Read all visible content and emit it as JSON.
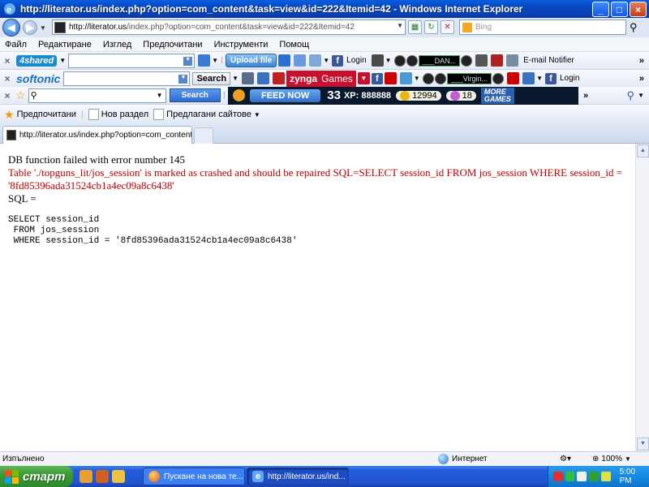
{
  "window": {
    "title": "http://literator.us/index.php?option=com_content&task=view&id=222&Itemid=42 - Windows Internet Explorer"
  },
  "address_bar": {
    "url_domain": "http://literator.us",
    "url_path": "/index.php?option=com_content&task=view&id=222&Itemid=42"
  },
  "search_box": {
    "placeholder": "Bing"
  },
  "menu": [
    "Файл",
    "Редактиране",
    "Изглед",
    "Предпочитани",
    "Инструменти",
    "Помощ"
  ],
  "toolbar_4shared": {
    "logo": "4shared",
    "upload_label": "Upload file",
    "login_label": "Login",
    "player_text": "___DAN...",
    "email_label": "E-mail Notifier"
  },
  "toolbar_softonic": {
    "logo": "softonic",
    "search_label": "Search",
    "zynga_label": "zynga",
    "zynga_games": "Games",
    "player_text": "___Virgin...",
    "login_label": "Login"
  },
  "toolbar_feed": {
    "search_label": "Search",
    "feed_now": "FEED NOW",
    "level": "33",
    "xp": "XP: 888888",
    "coins": "12994",
    "cash": "18",
    "more_games_line1": "MORE",
    "more_games_line2": "GAMES"
  },
  "favorites_bar": {
    "favorites_label": "Предпочитани",
    "new_section": "Нов раздел",
    "suggested_sites": "Предлагани сайтове"
  },
  "tab": {
    "title": "http://literator.us/index.php?option=com_content&ta..."
  },
  "content": {
    "line1": "DB function failed with error number 145",
    "line2": "Table './topguns_lit/jos_session' is marked as crashed and should be repaired SQL=SELECT session_id FROM jos_session WHERE session_id = '8fd85396ada31524cb1a4ec09a8c6438'",
    "line3": "SQL =",
    "sql": "SELECT session_id\n FROM jos_session\n WHERE session_id = '8fd85396ada31524cb1a4ec09a8c6438'"
  },
  "status_bar": {
    "status": "Изпълнено",
    "zone": "Интернет",
    "zoom": "100%"
  },
  "taskbar": {
    "start": "старт",
    "task1": "Пускане на нова те...",
    "task2": "http://literator.us/ind...",
    "clock": "5:00 PM"
  },
  "colors": {
    "error_red": "#c00000",
    "titlebar_blue": "#0a5fe0",
    "taskbar_blue": "#245edb",
    "start_green": "#3a9a35"
  }
}
